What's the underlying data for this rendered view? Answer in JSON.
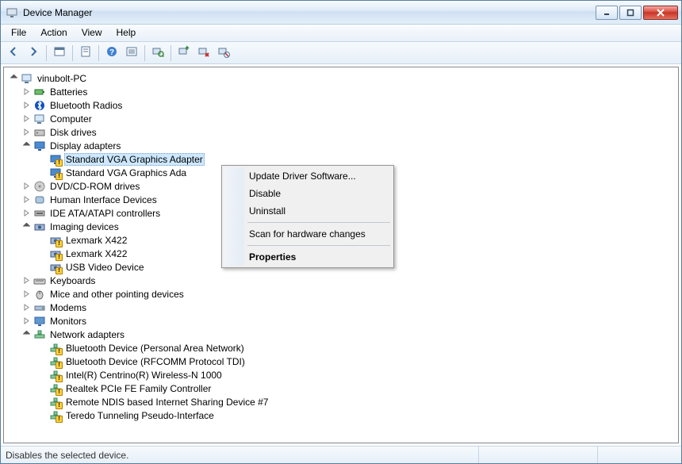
{
  "window_title": "Device Manager",
  "menus": [
    "File",
    "Action",
    "View",
    "Help"
  ],
  "toolbar_items": [
    {
      "name": "back",
      "glyph": "arrow-left"
    },
    {
      "name": "forward",
      "glyph": "arrow-right"
    },
    {
      "name": "sep"
    },
    {
      "name": "show-hide-console",
      "glyph": "console"
    },
    {
      "name": "sep"
    },
    {
      "name": "properties",
      "glyph": "props"
    },
    {
      "name": "sep"
    },
    {
      "name": "help",
      "glyph": "help"
    },
    {
      "name": "action-list",
      "glyph": "list"
    },
    {
      "name": "sep"
    },
    {
      "name": "scan-hardware",
      "glyph": "scan"
    },
    {
      "name": "sep"
    },
    {
      "name": "update-driver",
      "glyph": "update"
    },
    {
      "name": "uninstall",
      "glyph": "uninstall"
    },
    {
      "name": "disable",
      "glyph": "disable"
    }
  ],
  "root_label": "vinubolt-PC",
  "categories": [
    {
      "label": "Batteries",
      "icon": "battery",
      "expanded": false
    },
    {
      "label": "Bluetooth Radios",
      "icon": "bluetooth",
      "expanded": false
    },
    {
      "label": "Computer",
      "icon": "computer",
      "expanded": false
    },
    {
      "label": "Disk drives",
      "icon": "disk",
      "expanded": false
    },
    {
      "label": "Display adapters",
      "icon": "display",
      "expanded": true,
      "children": [
        {
          "label": "Standard VGA Graphics Adapter",
          "icon": "display",
          "warn": true,
          "selected": true
        },
        {
          "label": "Standard VGA Graphics Ada",
          "icon": "display",
          "warn": true
        }
      ]
    },
    {
      "label": "DVD/CD-ROM drives",
      "icon": "dvd",
      "expanded": false
    },
    {
      "label": "Human Interface Devices",
      "icon": "hid",
      "expanded": false
    },
    {
      "label": "IDE ATA/ATAPI controllers",
      "icon": "ide",
      "expanded": false
    },
    {
      "label": "Imaging devices",
      "icon": "imaging",
      "expanded": true,
      "children": [
        {
          "label": "Lexmark X422",
          "icon": "imaging",
          "warn": true
        },
        {
          "label": "Lexmark X422",
          "icon": "imaging",
          "warn": true
        },
        {
          "label": "USB Video Device",
          "icon": "imaging",
          "warn": true
        }
      ]
    },
    {
      "label": "Keyboards",
      "icon": "keyboard",
      "expanded": false
    },
    {
      "label": "Mice and other pointing devices",
      "icon": "mouse",
      "expanded": false
    },
    {
      "label": "Modems",
      "icon": "modem",
      "expanded": false
    },
    {
      "label": "Monitors",
      "icon": "monitor",
      "expanded": false
    },
    {
      "label": "Network adapters",
      "icon": "network",
      "expanded": true,
      "children": [
        {
          "label": "Bluetooth Device (Personal Area Network)",
          "icon": "network",
          "warn": true
        },
        {
          "label": "Bluetooth Device (RFCOMM Protocol TDI)",
          "icon": "network",
          "warn": true
        },
        {
          "label": "Intel(R) Centrino(R) Wireless-N 1000",
          "icon": "network",
          "warn": true
        },
        {
          "label": "Realtek PCIe FE Family Controller",
          "icon": "network",
          "warn": true
        },
        {
          "label": "Remote NDIS based Internet Sharing Device #7",
          "icon": "network",
          "warn": true
        },
        {
          "label": "Teredo Tunneling Pseudo-Interface",
          "icon": "network",
          "warn": true
        }
      ]
    }
  ],
  "context_menu": [
    {
      "label": "Update Driver Software...",
      "name": "update-driver"
    },
    {
      "label": "Disable",
      "name": "disable"
    },
    {
      "label": "Uninstall",
      "name": "uninstall"
    },
    {
      "sep": true
    },
    {
      "label": "Scan for hardware changes",
      "name": "scan-hardware"
    },
    {
      "sep": true
    },
    {
      "label": "Properties",
      "name": "properties",
      "bold": true
    }
  ],
  "status_text": "Disables the selected device."
}
